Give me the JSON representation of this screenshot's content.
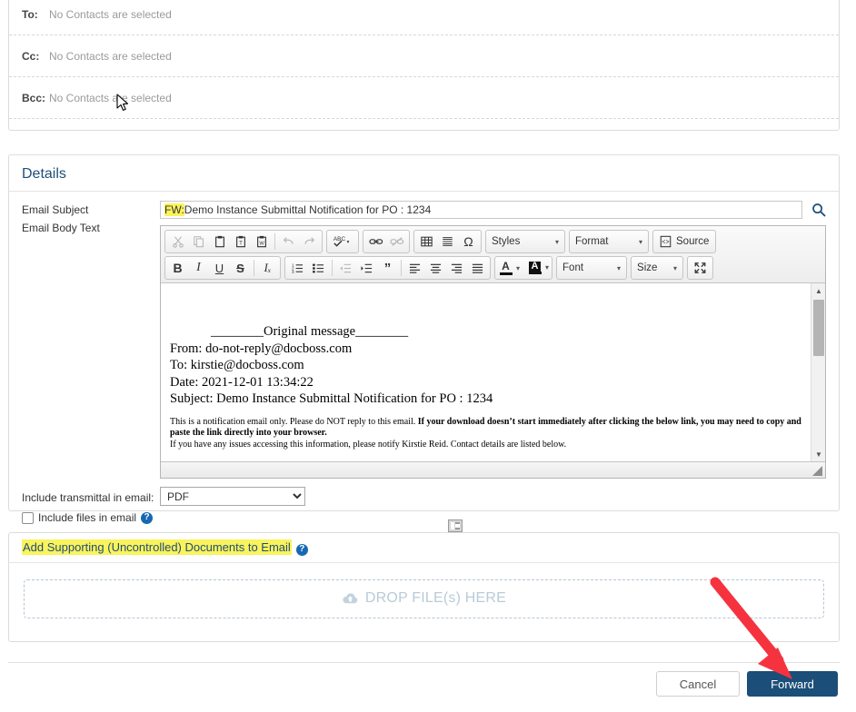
{
  "recipients": {
    "rows": [
      {
        "label": "To:",
        "value": "No Contacts are selected"
      },
      {
        "label": "Cc:",
        "value": "No Contacts are selected"
      },
      {
        "label": "Bcc:",
        "value": "No Contacts are selected"
      }
    ]
  },
  "details": {
    "title": "Details",
    "subject_label": "Email Subject",
    "body_label": "Email Body Text",
    "subject_prefix": "FW:",
    "subject_value": "Demo Instance Submittal Notification for PO : 1234",
    "search_icon": "search-icon"
  },
  "editor": {
    "toolbar_row1": [
      {
        "name": "cut-icon",
        "glyph": "✂",
        "disabled": true
      },
      {
        "name": "copy-icon",
        "glyph": "❐",
        "disabled": true
      },
      {
        "name": "paste-icon",
        "glyph": "ὌB",
        "disabled": false
      },
      {
        "name": "paste-as-text-icon",
        "glyph": "T",
        "disabled": false
      },
      {
        "name": "paste-from-word-icon",
        "glyph": "W",
        "disabled": false
      },
      {
        "name": "undo-icon",
        "glyph": "↶",
        "disabled": true
      },
      {
        "name": "redo-icon",
        "glyph": "↷",
        "disabled": true
      }
    ],
    "spellcheck_label": "ABC",
    "link_label": "link-icon",
    "unlink_label": "unlink-icon",
    "table_label": "table-icon",
    "hrule_label": "horizontal-rule-icon",
    "special_char": "Ω",
    "styles_label": "Styles",
    "format_label": "Format",
    "source_label": "Source",
    "bold_label": "B",
    "italic_label": "I",
    "underline_label": "U",
    "strike_label": "S",
    "removeformat_label": "Iₓ",
    "quote_label": "”",
    "textcolor_label": "A",
    "bgcolor_label": "A",
    "font_label": "Font",
    "size_label": "Size",
    "maximize_label": "maximize-icon",
    "body": {
      "divider": "________Original message________",
      "from": "From: do-not-reply@docboss.com",
      "to": "To: kirstie@docboss.com",
      "date": "Date: 2021-12-01 13:34:22",
      "subject": "Subject: Demo Instance Submittal Notification for PO : 1234",
      "note_plain_1": "This is a notification email only. Please do NOT reply to this email. ",
      "note_bold": "If your download doesn’t start immediately after clicking the below link, you may need to copy and paste the link directly into your browser.",
      "note_plain_2": "If you have any issues accessing this information, please notify Kirstie Reid. Contact details are listed below."
    }
  },
  "options": {
    "transmittal_label": "Include transmittal in email:",
    "transmittal_value": "PDF",
    "transmittal_options": [
      "PDF"
    ],
    "include_files_label": "Include files in email",
    "include_files_checked": false,
    "help_glyph": "?"
  },
  "supporting": {
    "splitter_icon": "panel-toggle-icon",
    "title": "Add Supporting (Uncontrolled) Documents to Email",
    "help_glyph": "?",
    "dropzone_text": "DROP FILE(s) HERE",
    "dropzone_icon": "cloud-upload-icon"
  },
  "footer": {
    "cancel_label": "Cancel",
    "forward_label": "Forward"
  },
  "annotation": {
    "arrow_color": "#f5333f",
    "arrow_name": "red-pointer-arrow"
  },
  "colors": {
    "accent": "#1f4e79",
    "primary_button": "#1b4e78",
    "highlight": "#faf35c",
    "dropzone_text": "#b9cbd8"
  }
}
